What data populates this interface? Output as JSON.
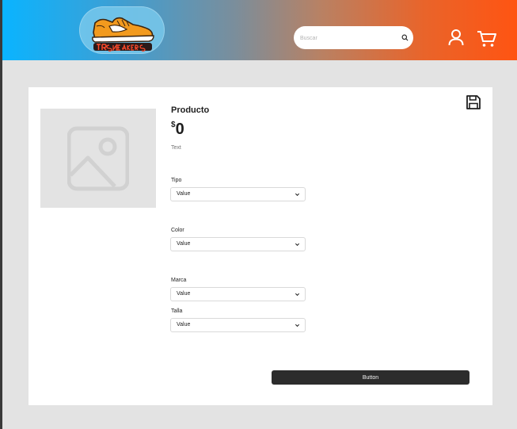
{
  "header": {
    "logo_text": "TR Sneakers",
    "search": {
      "placeholder": "Buscar",
      "value": ""
    },
    "icons": {
      "search": "search-icon",
      "user": "user-icon",
      "cart": "cart-icon"
    }
  },
  "product": {
    "title": "Producto",
    "currency_symbol": "$",
    "price": "0",
    "description": "Text",
    "image": "image-placeholder-icon",
    "save": "save-icon",
    "fields": [
      {
        "label": "Tipo",
        "value": "Value"
      },
      {
        "label": "Color",
        "value": "Value"
      },
      {
        "label": "Marca",
        "value": "Value"
      },
      {
        "label": "Talla",
        "value": "Value"
      }
    ],
    "button_label": "Button"
  },
  "colors": {
    "header_gradient_start": "#0ab4ff",
    "header_gradient_end": "#ff5412",
    "button_bg": "#2c2c2c",
    "page_bg": "#e3e3e3"
  }
}
